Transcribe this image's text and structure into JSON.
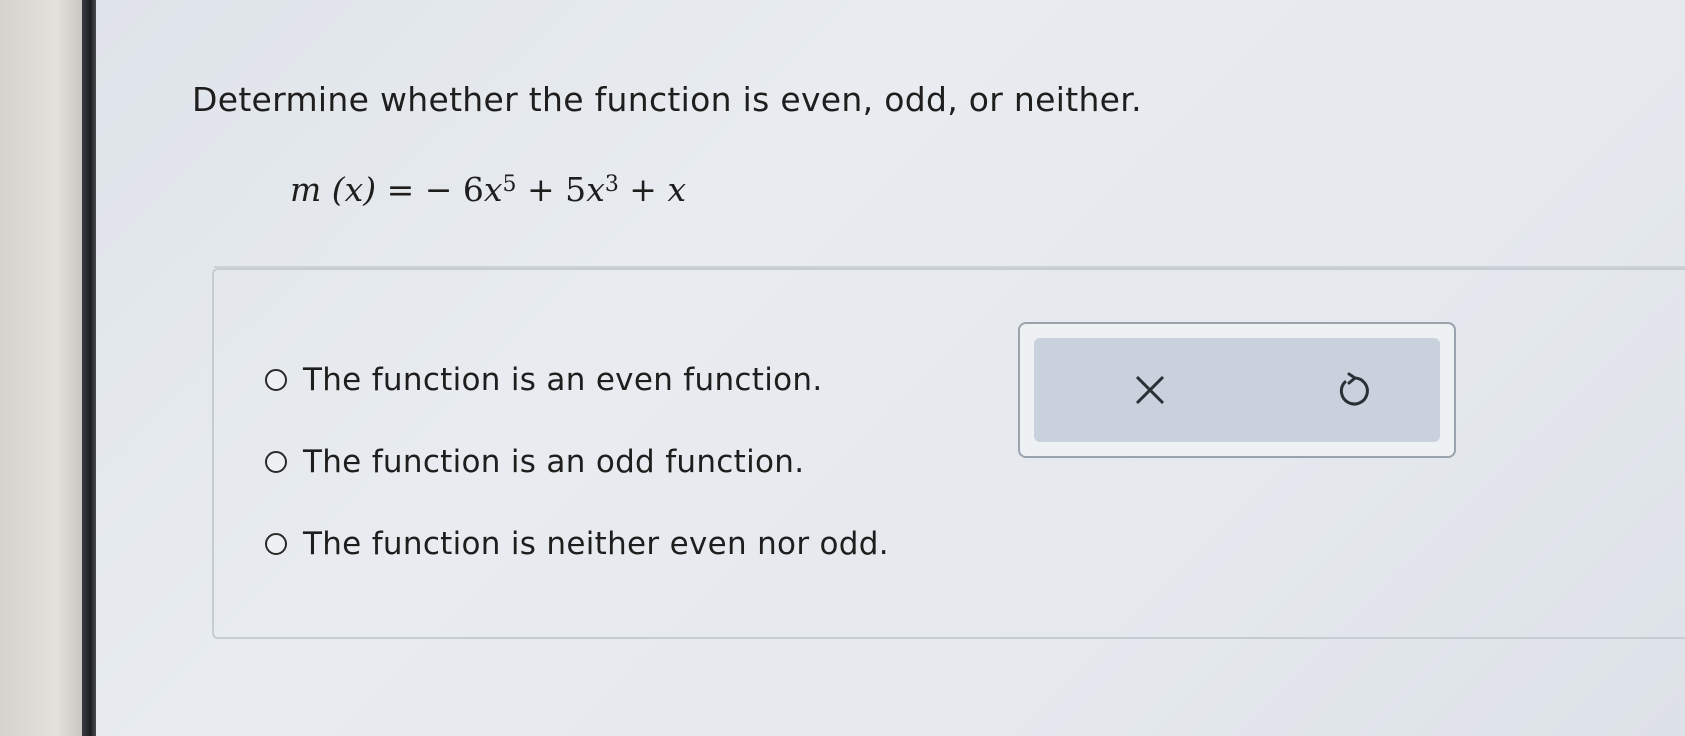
{
  "question": {
    "prompt": "Determine whether the function is even, odd, or neither.",
    "equation": {
      "lhs": "m (x) = ",
      "term1_coef": "− 6",
      "term1_var": "x",
      "term1_exp": "5",
      "term2_coef": " + 5",
      "term2_var": "x",
      "term2_exp": "3",
      "term3": " + ",
      "term3_var": "x"
    }
  },
  "options": [
    {
      "label": "The function is an even function."
    },
    {
      "label": "The function is an odd function."
    },
    {
      "label": "The function is neither even nor odd."
    }
  ],
  "tools": {
    "clear_icon": "close-icon",
    "undo_icon": "undo-icon"
  }
}
